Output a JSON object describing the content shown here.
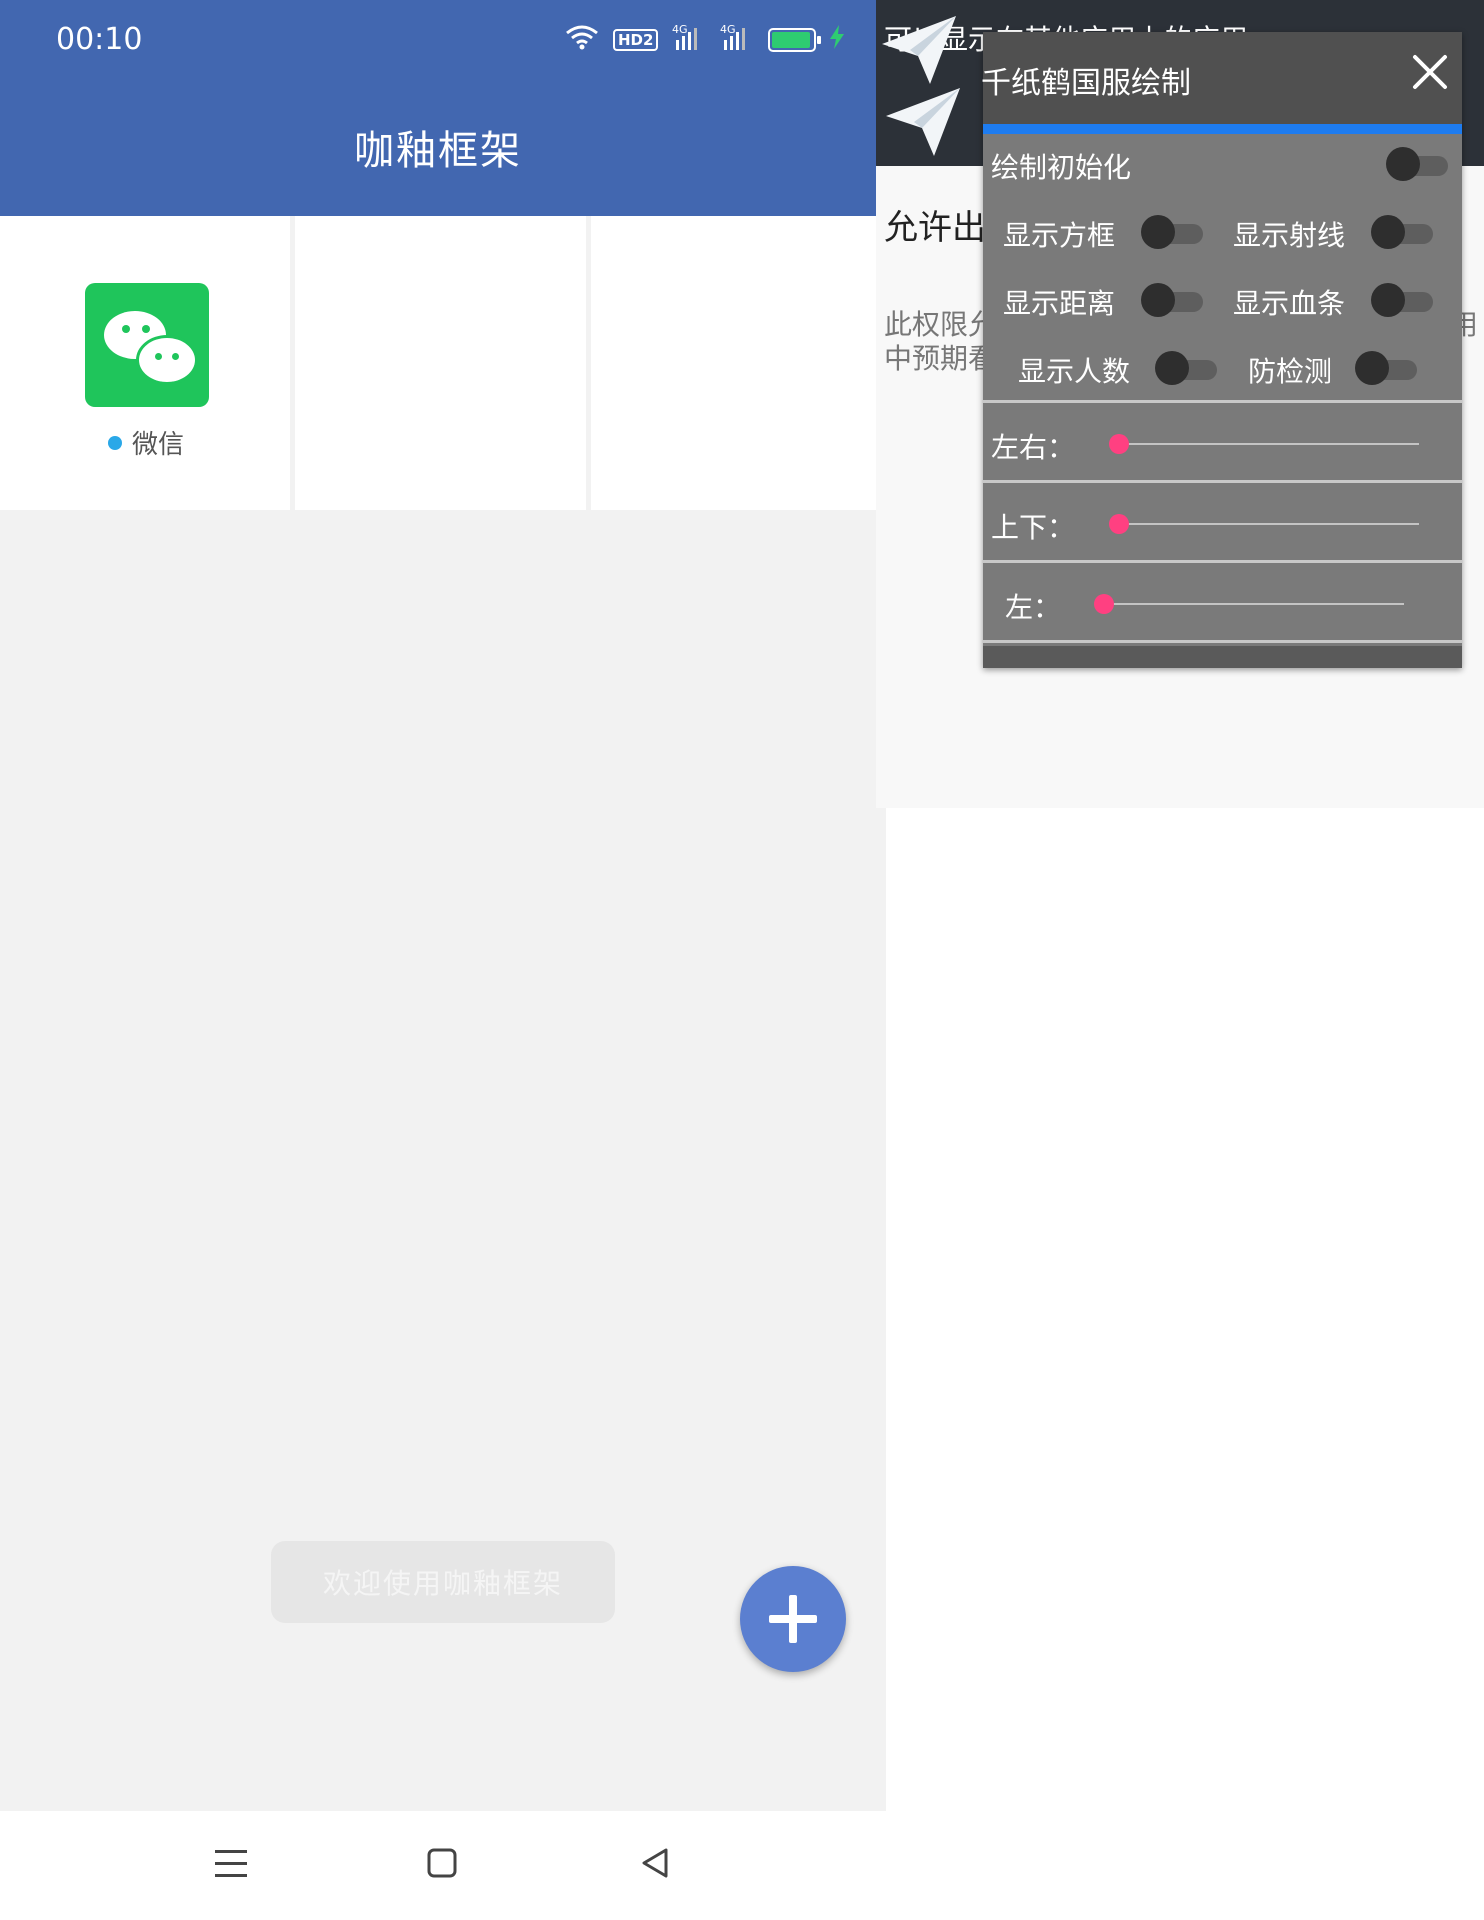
{
  "left": {
    "status_bar": {
      "time": "00:10",
      "network_badge": "HD2",
      "signal_1": "4G",
      "signal_2": "4G",
      "battery_color": "#2ecc71",
      "battery_fill": 1.0
    },
    "header": {
      "title": "咖釉框架",
      "color": "#4267b0"
    },
    "apps": [
      {
        "label": "微信",
        "icon": "wechat-icon",
        "status_dot_color": "#2aa8e8"
      }
    ],
    "toast": "欢迎使用咖釉框架",
    "fab_icon": "plus-icon",
    "nav_bar": {
      "icons": [
        "menu-icon",
        "home-square-icon",
        "back-triangle-icon"
      ]
    }
  },
  "right": {
    "header_text": "可以显示在其他应用上的应用",
    "allow_title": "允许出",
    "permission_text_line1": "此权限允",
    "permission_text_line1_end": "用",
    "permission_text_line2": "中预期看",
    "overlay": {
      "title": "千纸鹤国服绘制",
      "accent_color": "#1e7cf0",
      "toggles": [
        {
          "label": "绘制初始化",
          "on": false
        },
        {
          "label": "显示方框",
          "on": false
        },
        {
          "label": "显示射线",
          "on": false
        },
        {
          "label": "显示距离",
          "on": false
        },
        {
          "label": "显示血条",
          "on": false
        },
        {
          "label": "显示人数",
          "on": false
        },
        {
          "label": "防检测",
          "on": false
        }
      ],
      "sliders": [
        {
          "label": "左右：",
          "value": 0
        },
        {
          "label": "上下：",
          "value": 0
        },
        {
          "label": "左：",
          "value": 0
        }
      ],
      "slider_color": "#ff4081"
    }
  }
}
